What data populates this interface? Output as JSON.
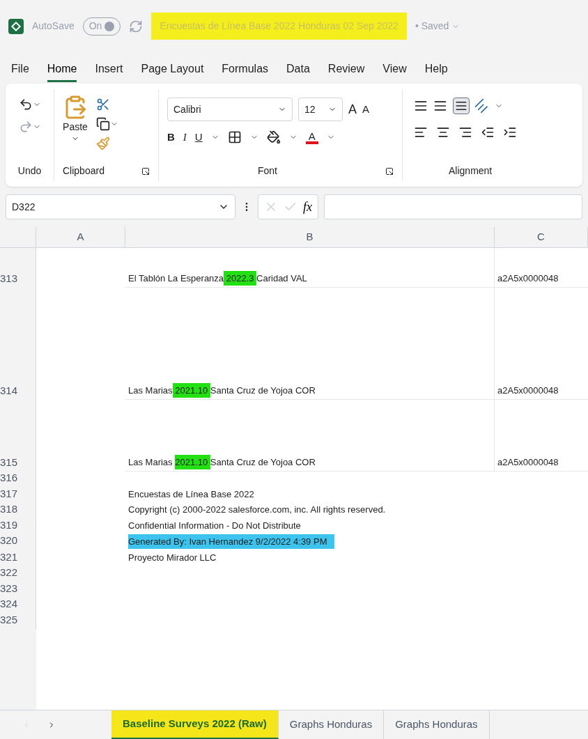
{
  "title_bar": {
    "autosave_label": "AutoSave",
    "autosave_toggle": {
      "label": "On",
      "on": true
    },
    "document_title": {
      "text": "Encuestas de Línea Base 2022 Honduras 02 Sep 2022",
      "color": "#f3ee1c"
    },
    "status": "• Saved"
  },
  "menu_tabs": [
    {
      "label": "File",
      "selected": false
    },
    {
      "label": "Home",
      "selected": true
    },
    {
      "label": "Insert",
      "selected": false
    },
    {
      "label": "Page Layout",
      "selected": false
    },
    {
      "label": "Formulas",
      "selected": false
    },
    {
      "label": "Data",
      "selected": false
    },
    {
      "label": "Review",
      "selected": false
    },
    {
      "label": "View",
      "selected": false
    },
    {
      "label": "Help",
      "selected": false
    }
  ],
  "ribbon": {
    "paste_label": "Paste",
    "font_name": "Calibri",
    "font_size": "12",
    "grow_font": "A",
    "shrink_font": "A",
    "bold": "B",
    "italic": "I",
    "underline": "U",
    "font_color": "A",
    "groups": [
      "Undo",
      "Clipboard",
      "Font",
      "Alignment"
    ]
  },
  "formula_bar": {
    "name_box": "D322",
    "function_label": "fx"
  },
  "columns": [
    "A",
    "B",
    "C"
  ],
  "rows": [
    {
      "number": "313",
      "b": [
        {
          "text": "El Tablón La Esperanza"
        },
        {
          "text": " 2022.3 ",
          "color": "#22e012"
        },
        {
          "text": "Caridad VAL"
        }
      ],
      "c": "a2A5x0000048"
    },
    {
      "number": "314",
      "b": [
        {
          "text": "Las Marias"
        },
        {
          "text": " 2021.10 ",
          "color": "#22e012"
        },
        {
          "text": "Santa Cruz de Yojoa COR"
        }
      ],
      "c": "a2A5x0000048"
    },
    {
      "number": "315",
      "b": [
        {
          "text": "Las Marias "
        },
        {
          "text": "2021.10 ",
          "color": "#22e012"
        },
        {
          "text": "Santa Cruz de Yojoa COR"
        }
      ],
      "c": "a2A5x0000048"
    },
    {
      "number": "316"
    },
    {
      "number": "317",
      "b": [
        {
          "text": "Encuestas de Línea Base 2022"
        }
      ]
    },
    {
      "number": "318",
      "b": [
        {
          "text": "Copyright (c) 2000-2022 salesforce.com, inc. All rights reserved."
        }
      ]
    },
    {
      "number": "319",
      "b": [
        {
          "text": "Confidential Information - Do Not Distribute"
        }
      ]
    },
    {
      "number": "320",
      "b": [
        {
          "text": "Generated By: Ivan Hernandez 9/2/2022 4:39 PM   ",
          "color": "#3cc3ee"
        }
      ]
    },
    {
      "number": "321",
      "b": [
        {
          "text": "Proyecto Mirador LLC"
        }
      ]
    },
    {
      "number": "322"
    },
    {
      "number": "323"
    },
    {
      "number": "324"
    },
    {
      "number": "325"
    }
  ],
  "sheet_tabs": [
    {
      "label": "Baseline Surveys 2022 (Raw)",
      "selected": true,
      "color": "#f5e61a"
    },
    {
      "label": "Graphs Honduras",
      "selected": false
    },
    {
      "label": "Graphs Honduras",
      "selected": false
    }
  ]
}
